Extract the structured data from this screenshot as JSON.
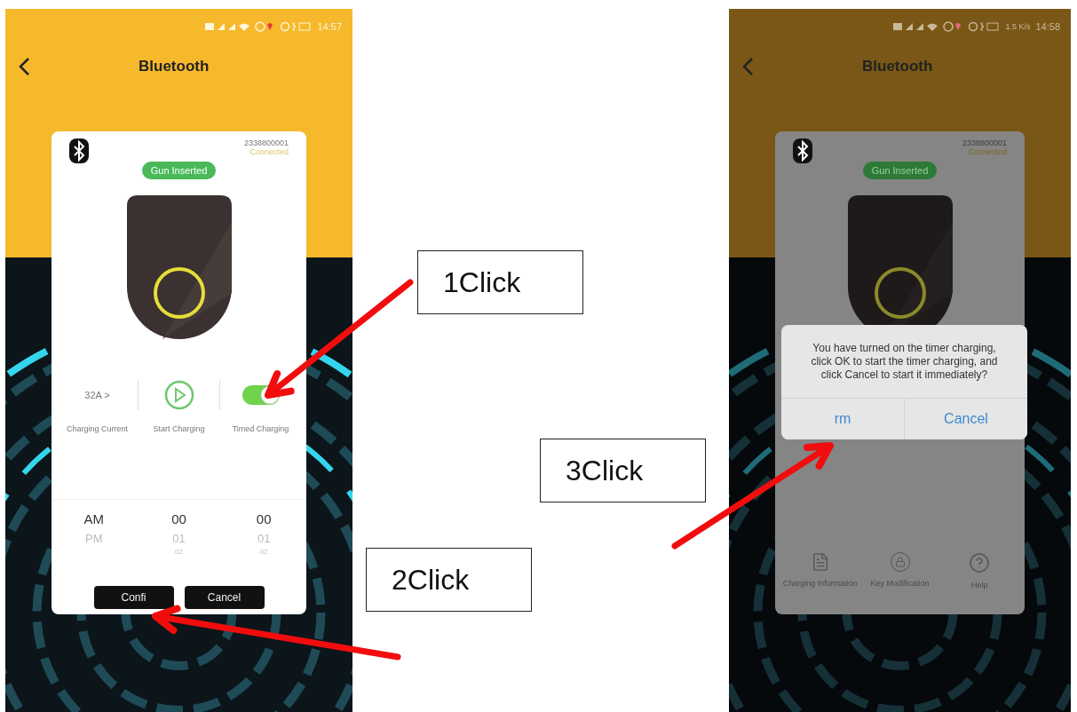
{
  "screens": [
    {
      "status_bar": {
        "time": "14:57"
      },
      "title": "Bluetooth",
      "dimmed": false,
      "device": {
        "serial": "2338800001",
        "state": "Connected"
      },
      "badge": "Gun Inserted",
      "controls": [
        {
          "kind": "value",
          "value": "32A >",
          "label": "Charging Current"
        },
        {
          "kind": "play",
          "label": "Start Charging"
        },
        {
          "kind": "toggle",
          "on": true,
          "label": "Timed Charging"
        }
      ],
      "picker": [
        [
          {
            "text": "AM",
            "selected": true
          },
          {
            "text": "PM",
            "selected": false
          }
        ],
        [
          {
            "text": "00",
            "selected": true
          },
          {
            "text": "01",
            "selected": false
          },
          {
            "text": "02",
            "selected": false
          }
        ],
        [
          {
            "text": "00",
            "selected": true
          },
          {
            "text": "01",
            "selected": false
          },
          {
            "text": "02",
            "selected": false
          }
        ]
      ],
      "buttons": [
        "Confi",
        "Cancel"
      ]
    },
    {
      "status_bar": {
        "time": "14:58",
        "speed": "1.5 K/s"
      },
      "title": "Bluetooth",
      "dimmed": true,
      "device": {
        "serial": "2338800001",
        "state": "Connected"
      },
      "badge": "Gun Inserted",
      "toolbar": [
        {
          "kind": "document",
          "label": "Charging Information"
        },
        {
          "kind": "lock",
          "label": "Key Modification"
        },
        {
          "kind": "help",
          "label": "Help"
        }
      ],
      "dialog": {
        "message": "You have turned on the timer charging, click OK to start the timer charging, and click Cancel to start it immediately?",
        "buttons": [
          "rm",
          "Cancel"
        ]
      }
    }
  ],
  "callouts": [
    {
      "label": "1Click"
    },
    {
      "label": "3Click"
    },
    {
      "label": "2Click"
    }
  ]
}
